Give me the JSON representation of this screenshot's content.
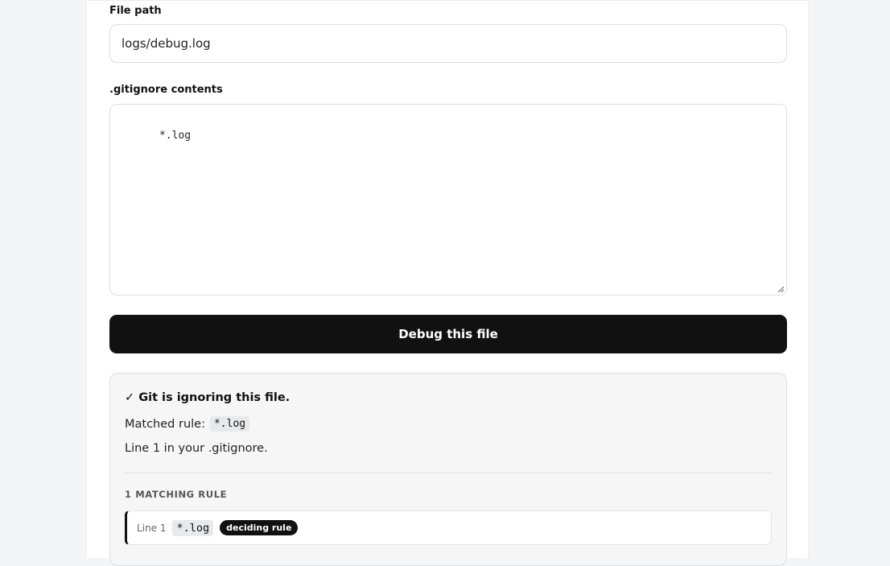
{
  "form": {
    "file_path_label": "File path",
    "file_path_value": "logs/debug.log",
    "gitignore_label": ".gitignore contents",
    "gitignore_value": "*.log",
    "submit_label": "Debug this file"
  },
  "result": {
    "verdict": "✓ Git is ignoring this file.",
    "matched_rule_label": "Matched rule:",
    "matched_rule": "*.log",
    "line_info": "Line 1 in your .gitignore.",
    "matching_rules_heading": "1 matching rule",
    "rules": [
      {
        "line": "Line 1",
        "pattern": "*.log",
        "badge": "deciding rule"
      }
    ]
  }
}
